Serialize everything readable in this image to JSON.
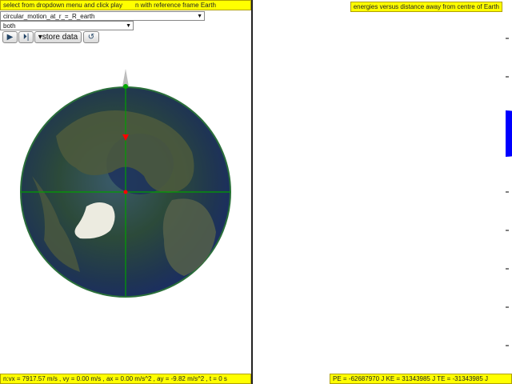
{
  "hint": {
    "part1": "select from dropdown menu and click play",
    "part2": "n with reference frame Earth"
  },
  "controls": {
    "scenario_value": "circular_motion_at_r_=_R_earth",
    "frame_value": "both",
    "play_icon": "play-icon",
    "step_icon": "step-forward-icon",
    "store_label": "store data",
    "reset_icon": "reset-icon"
  },
  "status": {
    "left": "n:vx = 7917.57 m/s , vy = 0.00 m/s , ax = 0.00 m/s^2 , ay = -9.82 m/s^2 , t = 0 s",
    "right": "PE = -62687970 J KE = 31343985 J TE = -31343985 J"
  },
  "energy_plot": {
    "title": "energies versus distance away from centre of Earth"
  },
  "colors": {
    "yellow_bar": "#ffff00",
    "orbit_line": "#008000",
    "marker_red": "#ff0000",
    "marker_green": "#00aa00",
    "pe_marker": "#000000",
    "ke_marker": "#cc00cc",
    "te_marker": "#2222cc",
    "earth_blob": "#0000ff",
    "arrow": "#5aa0d0",
    "grid": "#cfcfcf"
  }
}
